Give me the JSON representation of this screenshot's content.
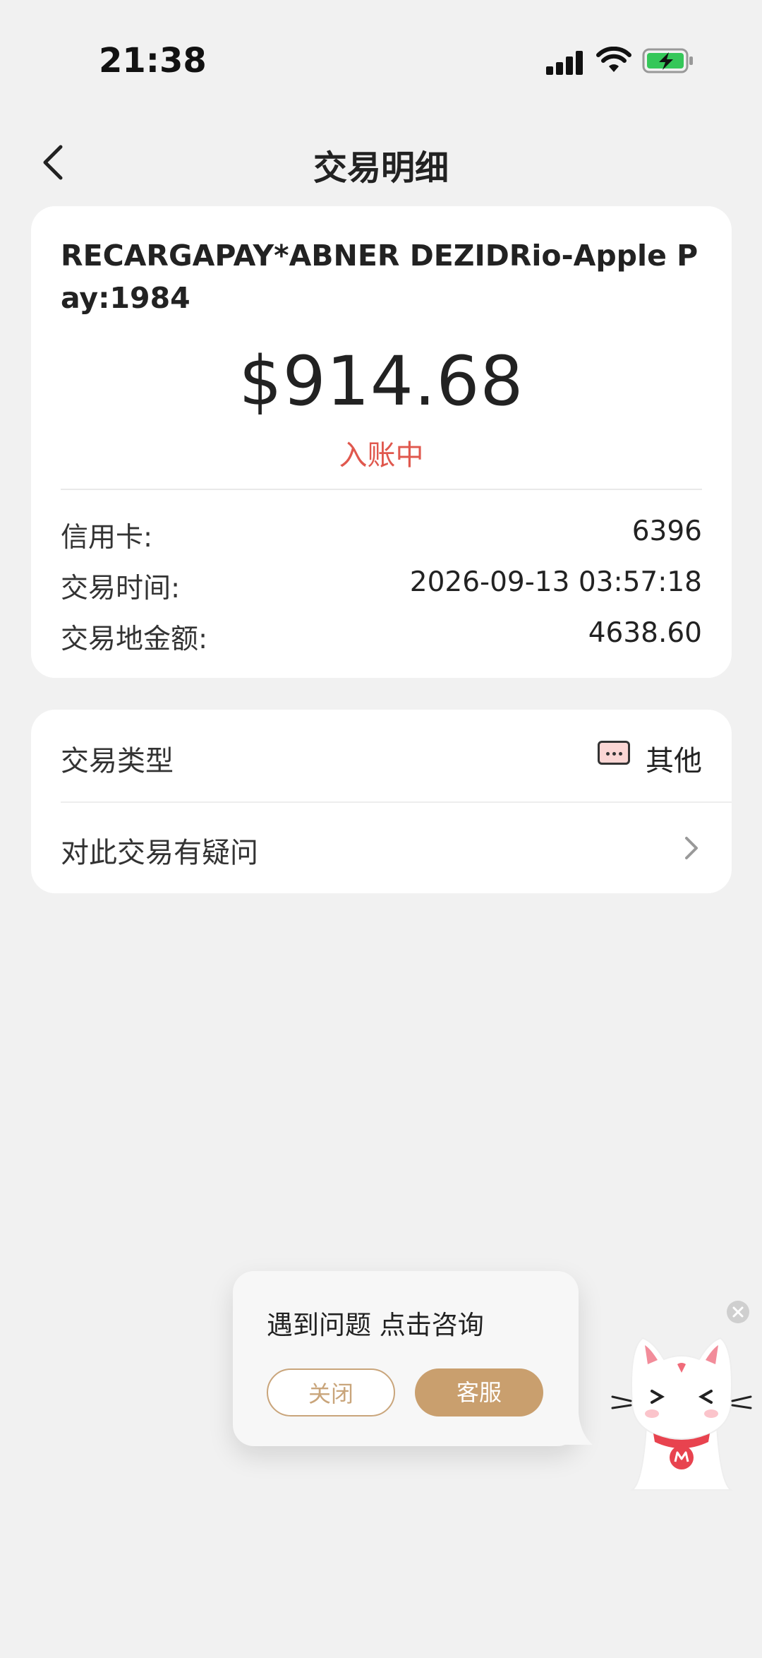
{
  "status_bar": {
    "time": "21:38"
  },
  "nav": {
    "title": "交易明细"
  },
  "transaction": {
    "merchant": "RECARGAPAY*ABNER DEZIDRio-Apple Pay:1984",
    "amount": "$914.68",
    "status": "入账中",
    "details": [
      {
        "label": "信用卡:",
        "value": "6396"
      },
      {
        "label": "交易时间:",
        "value": "2026-09-13 03:57:18"
      },
      {
        "label": "交易地金额:",
        "value": "4638.60"
      }
    ]
  },
  "options": {
    "type_label": "交易类型",
    "type_value": "其他",
    "dispute_label": "对此交易有疑问"
  },
  "popup": {
    "text": "遇到问题 点击咨询",
    "close_label": "关闭",
    "service_label": "客服"
  },
  "colors": {
    "accent": "#c99f6e",
    "status": "#e0584e",
    "background": "#f1f1f1"
  }
}
